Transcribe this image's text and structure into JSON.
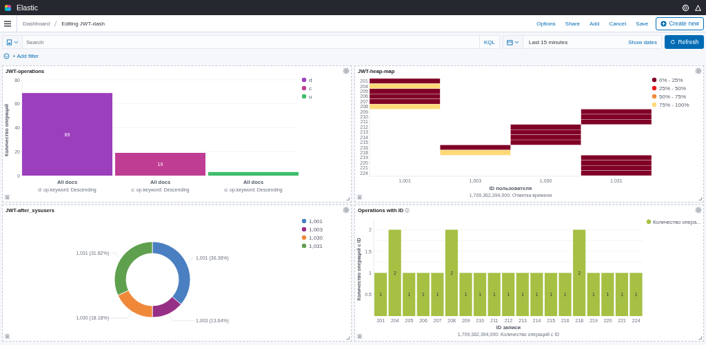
{
  "header": {
    "brand": "Elastic"
  },
  "breadcrumbs": [
    {
      "label": "Dashboard",
      "selected": false
    },
    {
      "label": "Editing JWT-dash",
      "selected": true
    }
  ],
  "top_nav": [
    "Options",
    "Share",
    "Add",
    "Cancel",
    "Save"
  ],
  "create_button": "Create new",
  "query": {
    "placeholder": "Search",
    "language": "KQL"
  },
  "time": {
    "range": "Last 15 minutes",
    "toggle": "Show dates",
    "refresh": "Refresh"
  },
  "add_filter": "+ Add filter",
  "panels": [
    {
      "kind": "split_bar",
      "title": "JWT-operations",
      "chart_data": {
        "type": "bar",
        "ylabel": "Количество операций",
        "categories": [
          "All docs",
          "All docs",
          "All docs"
        ],
        "values": [
          69,
          19,
          3
        ],
        "ylim": [
          0,
          80
        ],
        "yticks": [
          0,
          20,
          40,
          60,
          80
        ],
        "grid": true,
        "value_labels": [
          "69",
          "19",
          null
        ]
      },
      "legend": [
        {
          "label": "d",
          "color": "#9c3fbd"
        },
        {
          "label": "c",
          "color": "#bf3d93"
        },
        {
          "label": "u",
          "color": "#3ebd6b"
        }
      ],
      "splits": [
        {
          "caption": "d: op.keyword: Descending"
        },
        {
          "caption": "c: op.keyword: Descending"
        },
        {
          "caption": "u: op.keyword: Descending"
        }
      ]
    },
    {
      "kind": "heatmap",
      "title": "JWT-heap-map",
      "x_label": "ID пользователя",
      "caption": "1,709,362,394,000: Отметка времени",
      "columns": [
        "1,001",
        "1,003",
        "1,030",
        "1,031"
      ],
      "rows": [
        {
          "label": "201",
          "cells": [
            {
              "color": "#800026"
            },
            null,
            null,
            null
          ]
        },
        {
          "label": "204",
          "cells": [
            {
              "color": "#fed976"
            },
            null,
            null,
            null
          ]
        },
        {
          "label": "205",
          "cells": [
            {
              "color": "#800026"
            },
            null,
            null,
            null
          ]
        },
        {
          "label": "206",
          "cells": [
            {
              "color": "#800026"
            },
            null,
            null,
            null
          ]
        },
        {
          "label": "207",
          "cells": [
            {
              "color": "#800026"
            },
            null,
            null,
            null
          ]
        },
        {
          "label": "208",
          "cells": [
            {
              "color": "#fed976"
            },
            null,
            null,
            null
          ]
        },
        {
          "label": "209",
          "cells": [
            null,
            null,
            null,
            {
              "color": "#800026"
            }
          ]
        },
        {
          "label": "210",
          "cells": [
            null,
            null,
            null,
            {
              "color": "#800026"
            }
          ]
        },
        {
          "label": "211",
          "cells": [
            null,
            null,
            null,
            {
              "color": "#800026"
            }
          ]
        },
        {
          "label": "212",
          "cells": [
            null,
            null,
            {
              "color": "#800026"
            },
            null
          ]
        },
        {
          "label": "213",
          "cells": [
            null,
            null,
            {
              "color": "#800026"
            },
            null
          ]
        },
        {
          "label": "214",
          "cells": [
            null,
            null,
            {
              "color": "#800026"
            },
            null
          ]
        },
        {
          "label": "215",
          "cells": [
            null,
            null,
            {
              "color": "#800026"
            },
            null
          ]
        },
        {
          "label": "216",
          "cells": [
            null,
            {
              "color": "#800026"
            },
            null,
            null
          ]
        },
        {
          "label": "218",
          "cells": [
            null,
            {
              "color": "#fed976"
            },
            null,
            null
          ]
        },
        {
          "label": "219",
          "cells": [
            null,
            null,
            null,
            {
              "color": "#800026"
            }
          ]
        },
        {
          "label": "220",
          "cells": [
            null,
            null,
            null,
            {
              "color": "#800026"
            }
          ]
        },
        {
          "label": "221",
          "cells": [
            null,
            null,
            null,
            {
              "color": "#800026"
            }
          ]
        },
        {
          "label": "224",
          "cells": [
            null,
            null,
            null,
            {
              "color": "#800026"
            }
          ]
        }
      ],
      "legend": [
        {
          "label": "0% - 25%",
          "color": "#800026"
        },
        {
          "label": "25% - 50%",
          "color": "#e31a1c"
        },
        {
          "label": "50% - 75%",
          "color": "#f08c3a"
        },
        {
          "label": "75% - 100%",
          "color": "#fed976"
        }
      ]
    },
    {
      "kind": "donut",
      "title": "JWT-after_sysusers",
      "chart_data": {
        "type": "donut",
        "categories": [
          "1,001",
          "1,003",
          "1,030",
          "1,031"
        ],
        "values": [
          36.36,
          13.64,
          18.18,
          31.82
        ],
        "legend": "right",
        "value_labels": [
          "1,001 (36.36%)",
          "1,003 (13.64%)",
          "1,030 (18.18%)",
          "1,031 (31.82%)"
        ]
      },
      "legend": [
        {
          "color": "#4a7fc1"
        },
        {
          "color": "#962f86"
        },
        {
          "color": "#f0883a"
        },
        {
          "color": "#5fa04e"
        }
      ]
    },
    {
      "kind": "bar",
      "title": "Operations with ID",
      "info": true,
      "caption": "1,709,362,394,000: Количество операций с ID",
      "chart_data": {
        "type": "bar",
        "xlabel": "ID записи",
        "ylabel": "Количество операций с ID",
        "categories": [
          "201",
          "204",
          "205",
          "206",
          "207",
          "208",
          "209",
          "210",
          "211",
          "212",
          "213",
          "214",
          "215",
          "216",
          "218",
          "219",
          "220",
          "221",
          "224"
        ],
        "ylim": [
          0,
          2.25
        ],
        "yticks": [
          0.5,
          1,
          1.5,
          2
        ],
        "grid": true,
        "legend": "right",
        "data_labels": true,
        "series": [
          {
            "name": "Количество опера...",
            "color": "#a6c044",
            "values": [
              1,
              2,
              1,
              1,
              1,
              2,
              1,
              1,
              1,
              1,
              1,
              1,
              1,
              1,
              2,
              1,
              1,
              1,
              1
            ]
          }
        ]
      }
    }
  ]
}
